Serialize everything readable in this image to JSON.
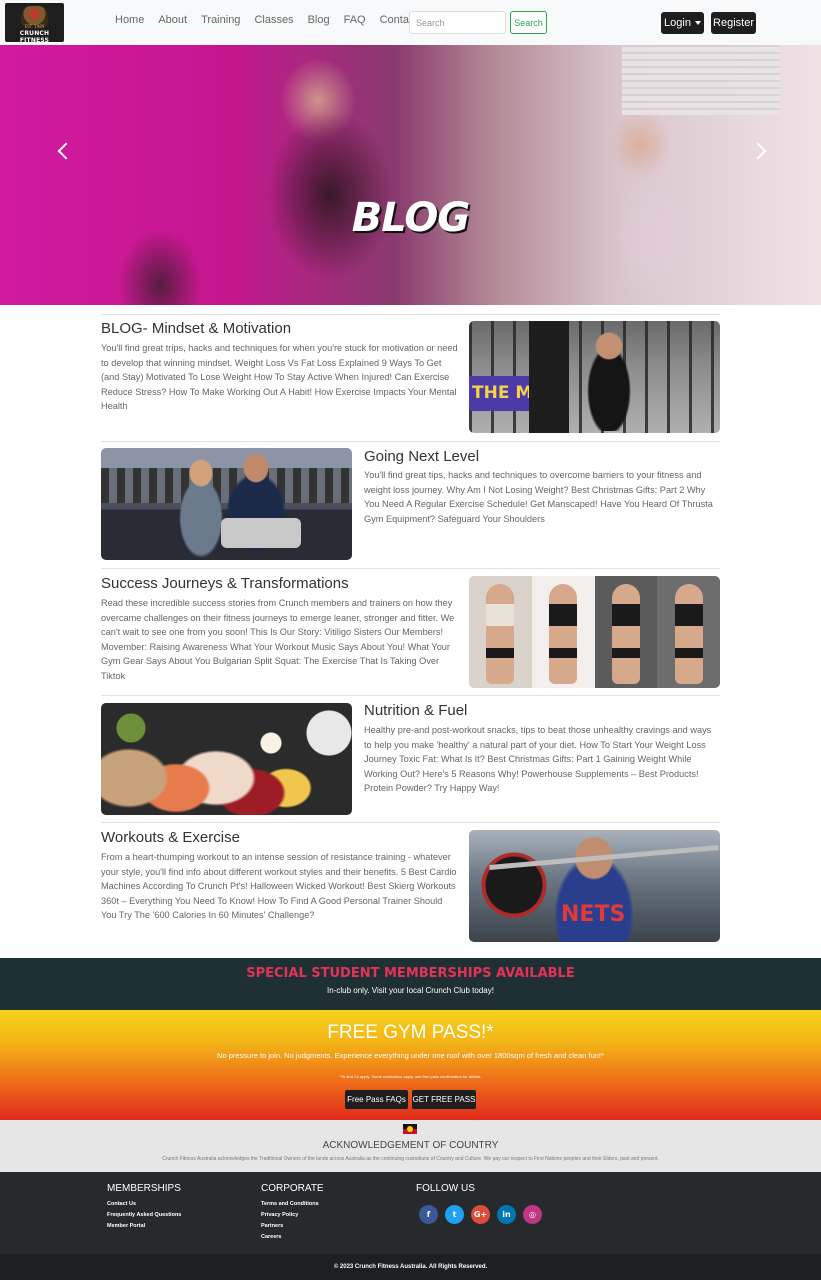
{
  "brand": {
    "logo_text": "CRUNCH FITNESS",
    "logo_sub": "EST. 1989"
  },
  "nav": {
    "items": [
      "Home",
      "About",
      "Training",
      "Classes",
      "Blog",
      "FAQ",
      "Contact"
    ],
    "search_placeholder": "Search",
    "search_label": "Search",
    "login_label": "Login",
    "register_label": "Register"
  },
  "hero": {
    "title": "BLOG"
  },
  "sections": [
    {
      "title": "BLOG- Mindset & Motivation",
      "text": "You'll find great trips, hacks and techniques for when you're stuck for motivation or need to develop that winning mindset. Weight Loss Vs Fat Loss Explained 9 Ways To Get (and Stay) Motivated To Lose Weight How To Stay Active When Injured! Can Exercise Reduce Stress? How To Make Working Out A Habit! How Exercise Impacts Your Mental Health",
      "image_wall_text": "THE MUS"
    },
    {
      "title": "Going Next Level",
      "text": "You'll find great tips, hacks and techniques to overcome barriers to your fitness and weight loss journey. Why Am I Not Losing Weight? Best Christmas Gifts: Part 2 Why You Need A Regular Exercise Schedule! Get Manscaped! Have You Heard Of Thrusta Gym Equipment? Safeguard Your Shoulders"
    },
    {
      "title": "Success Journeys & Transformations",
      "text": "Read these incredible success stories from Crunch members and trainers on how they overcame challenges on their fitness journeys to emerge leaner, stronger and fitter. We can't wait to see one from you soon! This Is Our Story: Vitiligo Sisters Our Members! Movember: Raising Awareness What Your Workout Music Says About You! What Your Gym Gear Says About You Bulgarian Split Squat: The Exercise That Is Taking Over Tiktok"
    },
    {
      "title": "Nutrition & Fuel",
      "text": "Healthy pre-and post-workout snacks, tips to beat those unhealthy cravings and ways to help you make 'healthy' a natural part of your diet. How To Start Your Weight Loss Journey Toxic Fat: What Is It? Best Christmas Gifts: Part 1 Gaining Weight While Working Out? Here's 5 Reasons Why! Powerhouse Supplements – Best Products! Protein Powder? Try Happy Way!"
    },
    {
      "title": "Workouts & Exercise",
      "text": "From a heart-thumping workout to an intense session of resistance training - whatever your style, you'll find info about different workout styles and their benefits. 5 Best Cardio Machines According To Crunch Pt's! Halloween Wicked Workout! Best Skierg Workouts 360t – Everything You Need To Know! How To Find A Good Personal Trainer Should You Try The '600 Calories In 60 Minutes' Challenge?",
      "image_jersey_text": "NETS"
    }
  ],
  "student_banner": {
    "title": "SPECIAL STUDENT MEMBERSHIPS AVAILABLE",
    "subtitle": "In-club only. Visit your local Crunch Club today!"
  },
  "free_pass": {
    "title": "FREE GYM PASS!*",
    "subtitle": "No pressure to join. No judgments. Experience everything under one roof with over 1800sqm of fresh and clean fun!*",
    "fine_print": "*Ts and Cs apply. Some restrictions apply, see free pass confirmation for details.",
    "faq_button": "Free Pass FAQs",
    "get_button": "GET FREE PASS"
  },
  "acknowledgement": {
    "title": "ACKNOWLEDGEMENT OF COUNTRY",
    "text": "Crunch Fitness Australia acknowledges the Traditional Owners of the lands across Australia as the continuing custodians of Country and Culture. We pay our respect to First Nations peoples and their Elders, past and present."
  },
  "footer": {
    "memberships": {
      "heading": "MEMBERSHIPS",
      "links": [
        "Contact Us",
        "Frequently Asked Questions",
        "Member Portal"
      ]
    },
    "corporate": {
      "heading": "CORPORATE",
      "links": [
        "Terms and Conditions",
        "Privacy Policy",
        "Partners",
        "Careers"
      ]
    },
    "follow": {
      "heading": "FOLLOW US",
      "icons": [
        {
          "name": "facebook-icon",
          "glyph": "f",
          "color": "#3b5998"
        },
        {
          "name": "twitter-icon",
          "glyph": "t",
          "color": "#1da1f2"
        },
        {
          "name": "google-plus-icon",
          "glyph": "G+",
          "color": "#dd4b39"
        },
        {
          "name": "linkedin-icon",
          "glyph": "in",
          "color": "#0077b5"
        },
        {
          "name": "instagram-icon",
          "glyph": "◎",
          "color": "#c13584"
        }
      ]
    },
    "copyright": "© 2023 Crunch Fitness Australia. All Rights Reserved."
  }
}
